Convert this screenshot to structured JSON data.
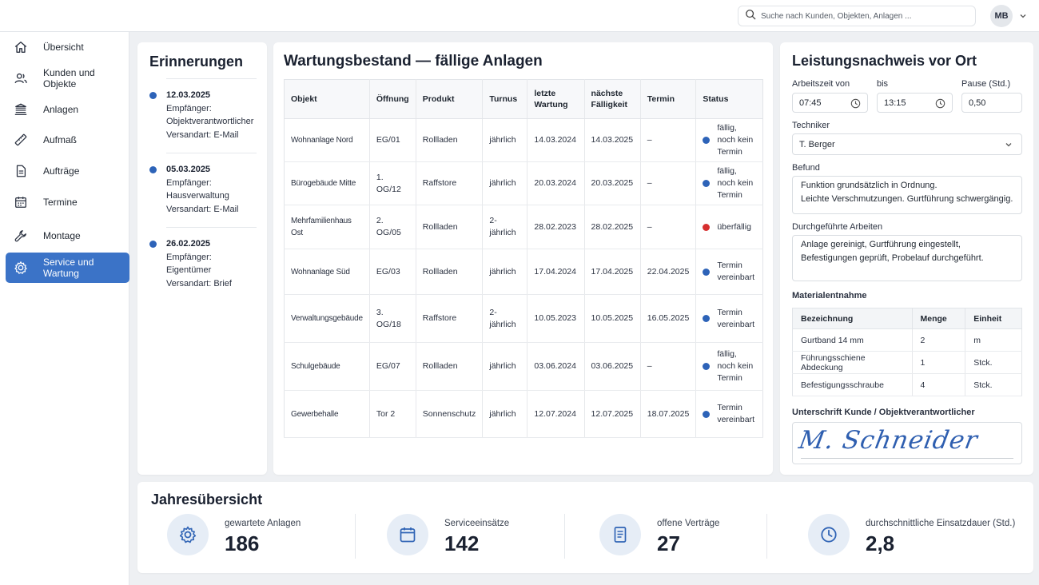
{
  "search": {
    "placeholder": "Suche nach Kunden, Objekten, Anlagen ..."
  },
  "user": {
    "initials": "MB"
  },
  "sidebar": {
    "items": [
      {
        "label": "Übersicht",
        "icon": "home-icon"
      },
      {
        "label": "Kunden und Objekte",
        "icon": "users-icon"
      },
      {
        "label": "Anlagen",
        "icon": "building-icon"
      },
      {
        "label": "Aufmaß",
        "icon": "ruler-icon"
      },
      {
        "label": "Aufträge",
        "icon": "document-icon"
      },
      {
        "label": "Termine",
        "icon": "calendar-icon"
      },
      {
        "label": "Montage",
        "icon": "wrench-icon"
      },
      {
        "label": "Service und Wartung",
        "icon": "gear-icon",
        "active": true
      }
    ]
  },
  "reminders": {
    "title": "Erinnerungen",
    "items": [
      {
        "date": "12.03.2025",
        "line1": "Empfänger:",
        "line2": "Objektverantwortlicher",
        "line3": "Versandart: E-Mail"
      },
      {
        "date": "05.03.2025",
        "line1": "Empfänger:",
        "line2": "Hausverwaltung",
        "line3": "Versandart: E-Mail"
      },
      {
        "date": "26.02.2025",
        "line1": "Empfänger:",
        "line2": "Eigentümer",
        "line3": "Versandart: Brief"
      }
    ]
  },
  "maintenance": {
    "title": "Wartungsbestand — fällige Anlagen",
    "headers": [
      "Objekt",
      "Öffnung",
      "Produkt",
      "Turnus",
      "letzte Wartung",
      "nächste Fälligkeit",
      "Termin",
      "Status"
    ],
    "rows": [
      {
        "objekt": "Wohnanlage Nord",
        "oeffnung": "EG/01",
        "produkt": "Rollladen",
        "turnus": "jährlich",
        "letzte": "14.03.2024",
        "naechste": "14.03.2025",
        "termin": "–",
        "status": "fällig, noch kein Termin",
        "status_color": "#2d63b8"
      },
      {
        "objekt": "Bürogebäude Mitte",
        "oeffnung": "1. OG/12",
        "produkt": "Raffstore",
        "turnus": "jährlich",
        "letzte": "20.03.2024",
        "naechste": "20.03.2025",
        "termin": "–",
        "status": "fällig, noch kein Termin",
        "status_color": "#2d63b8"
      },
      {
        "objekt": "Mehrfamilienhaus Ost",
        "oeffnung": "2. OG/05",
        "produkt": "Rollladen",
        "turnus": "2-jährlich",
        "letzte": "28.02.2023",
        "naechste": "28.02.2025",
        "termin": "–",
        "status": "überfällig",
        "status_color": "#d62f2f"
      },
      {
        "objekt": "Wohnanlage Süd",
        "oeffnung": "EG/03",
        "produkt": "Rollladen",
        "turnus": "jährlich",
        "letzte": "17.04.2024",
        "naechste": "17.04.2025",
        "termin": "22.04.2025",
        "status": "Termin vereinbart",
        "status_color": "#2d63b8"
      },
      {
        "objekt": "Verwaltungsgebäude",
        "oeffnung": "3. OG/18",
        "produkt": "Raffstore",
        "turnus": "2-jährlich",
        "letzte": "10.05.2023",
        "naechste": "10.05.2025",
        "termin": "16.05.2025",
        "status": "Termin vereinbart",
        "status_color": "#2d63b8"
      },
      {
        "objekt": "Schulgebäude",
        "oeffnung": "EG/07",
        "produkt": "Rollladen",
        "turnus": "jährlich",
        "letzte": "03.06.2024",
        "naechste": "03.06.2025",
        "termin": "–",
        "status": "fällig, noch kein Termin",
        "status_color": "#2d63b8"
      },
      {
        "objekt": "Gewerbehalle",
        "oeffnung": "Tor 2",
        "produkt": "Sonnenschutz",
        "turnus": "jährlich",
        "letzte": "12.07.2024",
        "naechste": "12.07.2025",
        "termin": "18.07.2025",
        "status": "Termin vereinbart",
        "status_color": "#2d63b8"
      }
    ]
  },
  "service_report": {
    "title": "Leistungsnachweis vor Ort",
    "worktime_from_label": "Arbeitszeit von",
    "worktime_from": "07:45",
    "worktime_to_label": "bis",
    "worktime_to": "13:15",
    "pause_label": "Pause (Std.)",
    "pause": "0,50",
    "technician_label": "Techniker",
    "technician": "T. Berger",
    "finding_label": "Befund",
    "finding": "Funktion grundsätzlich in Ordnung.\nLeichte Verschmutzungen. Gurtführung schwergängig.",
    "work_label": "Durchgeführte Arbeiten",
    "work": "Anlage gereinigt, Gurtführung eingestellt,\nBefestigungen geprüft, Probelauf durchgeführt.",
    "materials_label": "Materialentnahme",
    "materials_headers": [
      "Bezeichnung",
      "Menge",
      "Einheit"
    ],
    "materials": [
      {
        "name": "Gurtband 14 mm",
        "qty": "2",
        "unit": "m"
      },
      {
        "name": "Führungsschiene Abdeckung",
        "qty": "1",
        "unit": "Stck."
      },
      {
        "name": "Befestigungsschraube",
        "qty": "4",
        "unit": "Stck."
      }
    ],
    "signature_label": "Unterschrift Kunde / Objektverantwortlicher",
    "signature": "M. Schneider"
  },
  "yearly": {
    "title": "Jahresübersicht",
    "stats": [
      {
        "label": "gewartete Anlagen",
        "value": "186",
        "icon": "gear-icon"
      },
      {
        "label": "Serviceeinsätze",
        "value": "142",
        "icon": "calendar-icon"
      },
      {
        "label": "offene Verträge",
        "value": "27",
        "icon": "document-icon"
      },
      {
        "label": "durchschnittliche Einsatzdauer (Std.)",
        "value": "2,8",
        "icon": "clock-icon"
      }
    ]
  },
  "colors": {
    "accent": "#3b73c7",
    "status_blue": "#2d63b8",
    "status_red": "#d62f2f"
  }
}
